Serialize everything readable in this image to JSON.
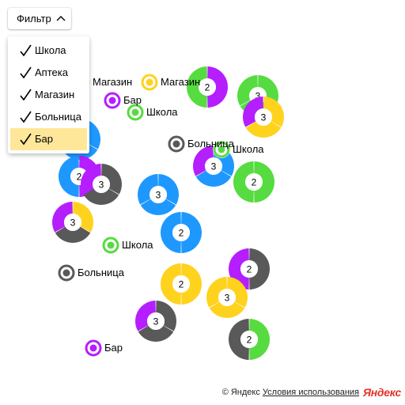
{
  "colors": {
    "school": "#56db40",
    "pharmacy": "#1e98ff",
    "shop": "#ffd21e",
    "hospital": "#595959",
    "bar": "#b51eff"
  },
  "filter": {
    "button_label": "Фильтр",
    "icon": "chevron-up-icon",
    "items": [
      {
        "label": "Школа",
        "checked": true,
        "selected": false
      },
      {
        "label": "Аптека",
        "checked": true,
        "selected": false
      },
      {
        "label": "Магазин",
        "checked": true,
        "selected": false
      },
      {
        "label": "Больница",
        "checked": true,
        "selected": false
      },
      {
        "label": "Бар",
        "checked": true,
        "selected": true
      }
    ]
  },
  "placemarks": [
    {
      "label": "Магазин",
      "category": "shop"
    },
    {
      "label": "Магазин",
      "category": "shop"
    },
    {
      "label": "Бар",
      "category": "bar"
    },
    {
      "label": "Школа",
      "category": "school"
    },
    {
      "label": "Больница",
      "category": "hospital"
    },
    {
      "label": "Школа",
      "category": "school"
    },
    {
      "label": "Школа",
      "category": "school"
    },
    {
      "label": "Больница",
      "category": "hospital"
    },
    {
      "label": "Бар",
      "category": "bar"
    }
  ],
  "clusters": [
    {
      "count": "2",
      "segments": [
        "bar",
        "school"
      ]
    },
    {
      "count": "3",
      "segments": [
        "school",
        "school",
        "school"
      ]
    },
    {
      "count": "3",
      "segments": [
        "shop",
        "shop",
        "bar"
      ]
    },
    {
      "count": "3",
      "segments": [
        "pharmacy",
        "pharmacy",
        "pharmacy"
      ]
    },
    {
      "count": "3",
      "segments": [
        "pharmacy",
        "pharmacy",
        "bar"
      ]
    },
    {
      "count": "2",
      "segments": [
        "school",
        "school"
      ]
    },
    {
      "count": "2",
      "segments": [
        "bar",
        "pharmacy"
      ]
    },
    {
      "count": "3",
      "segments": [
        "hospital",
        "hospital",
        "bar"
      ]
    },
    {
      "count": "3",
      "segments": [
        "pharmacy",
        "pharmacy",
        "pharmacy"
      ]
    },
    {
      "count": "3",
      "segments": [
        "shop",
        "hospital",
        "bar"
      ]
    },
    {
      "count": "2",
      "segments": [
        "pharmacy",
        "pharmacy"
      ]
    },
    {
      "count": "2",
      "segments": [
        "hospital",
        "bar"
      ]
    },
    {
      "count": "2",
      "segments": [
        "shop",
        "shop"
      ]
    },
    {
      "count": "3",
      "segments": [
        "shop",
        "shop",
        "shop"
      ]
    },
    {
      "count": "3",
      "segments": [
        "hospital",
        "hospital",
        "bar"
      ]
    },
    {
      "count": "2",
      "segments": [
        "school",
        "hospital"
      ]
    }
  ],
  "footer": {
    "copyright": "© Яндекс",
    "terms_link": "Условия использования",
    "logo": "Яндекс"
  }
}
